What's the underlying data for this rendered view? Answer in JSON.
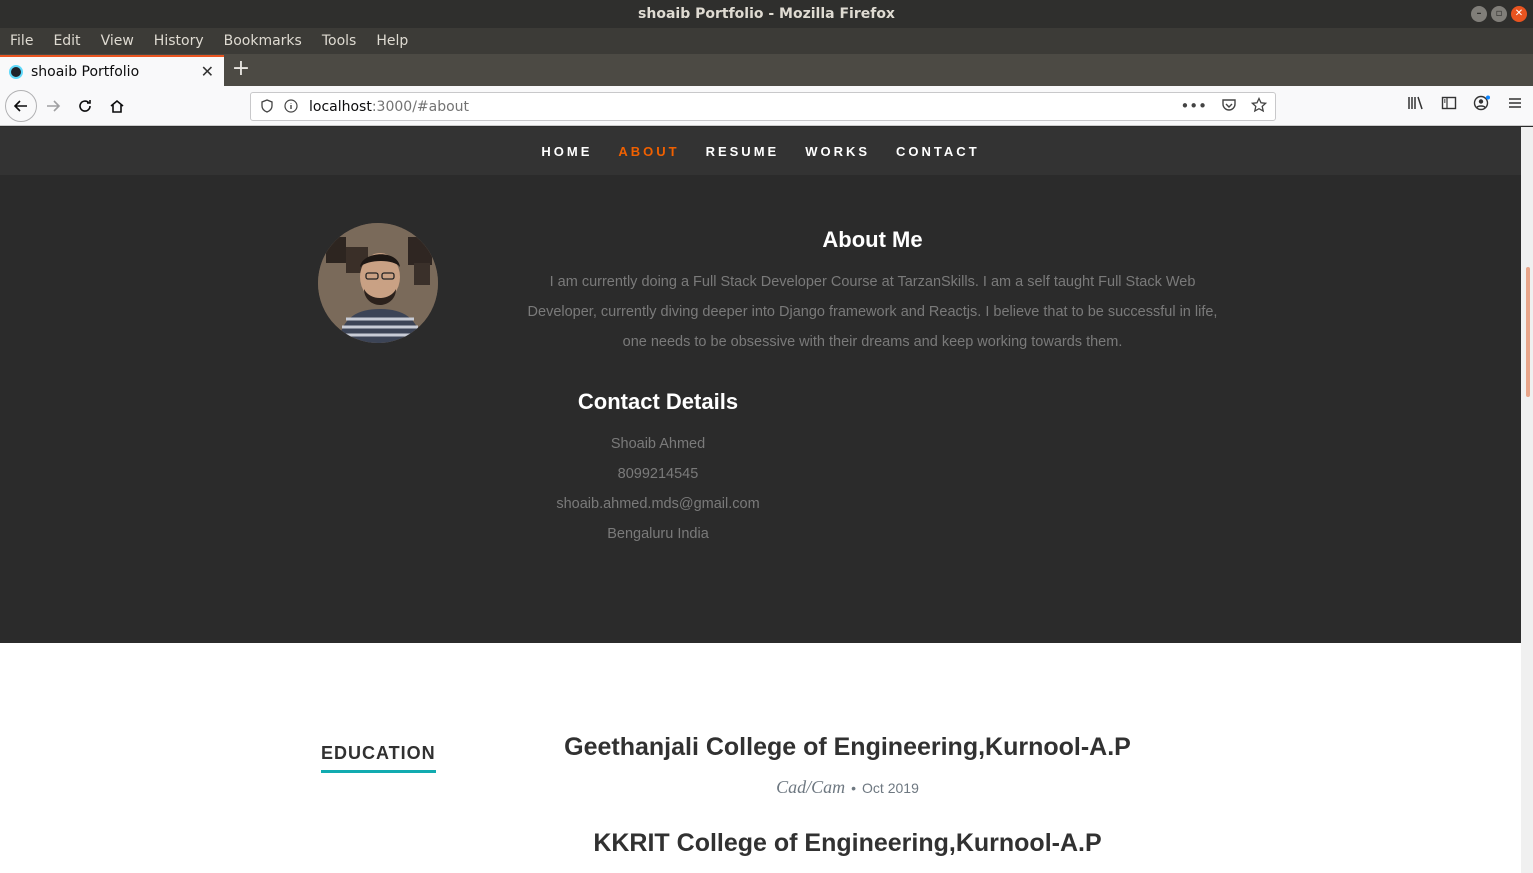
{
  "window": {
    "title": "shoaib Portfolio - Mozilla Firefox"
  },
  "menu": [
    "File",
    "Edit",
    "View",
    "History",
    "Bookmarks",
    "Tools",
    "Help"
  ],
  "tab": {
    "title": "shoaib Portfolio",
    "close": "✕",
    "new_tab": "+"
  },
  "address": {
    "host": "localhost",
    "path": ":3000/#about"
  },
  "site_nav": {
    "items": [
      "HOME",
      "ABOUT",
      "RESUME",
      "WORKS",
      "CONTACT"
    ],
    "active": "ABOUT",
    "accent": "#f06000"
  },
  "about": {
    "heading": "About Me",
    "bio": "I am currently doing a Full Stack Developer Course at TarzanSkills. I am a self taught Full Stack Web Developer, currently diving deeper into Django framework and Reactjs. I believe that to be successful in life, one needs to be obsessive with their dreams and keep working towards them.",
    "contact_heading": "Contact Details",
    "contact": {
      "name": "Shoaib Ahmed",
      "phone": "8099214545",
      "email": "shoaib.ahmed.mds@gmail.com",
      "location": "Bengaluru India"
    }
  },
  "resume": {
    "section_label": "EDUCATION",
    "accent": "#11abb0",
    "schools": [
      {
        "name": "Geethanjali College of Engineering,Kurnool-A.P",
        "degree": "Cad/Cam",
        "bullet": "•",
        "date": "Oct 2019"
      },
      {
        "name": "KKRIT College of Engineering,Kurnool-A.P"
      }
    ]
  }
}
